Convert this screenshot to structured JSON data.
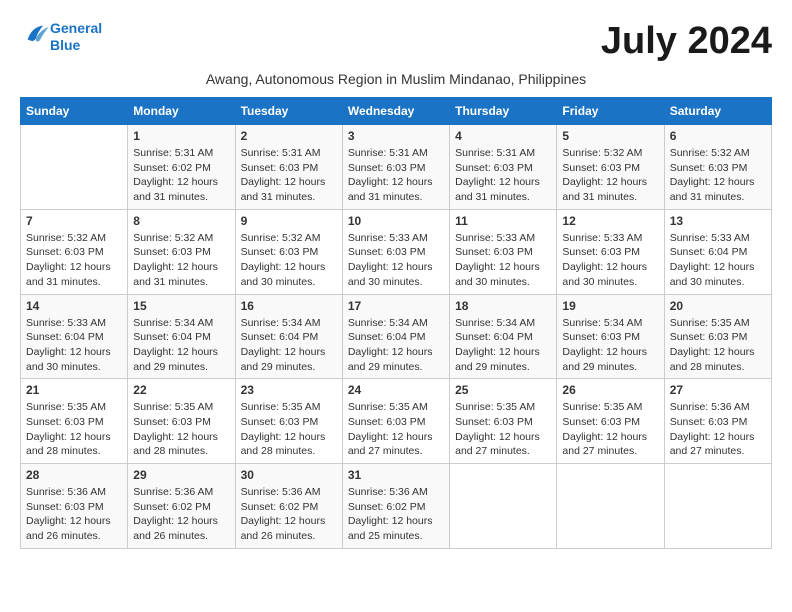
{
  "logo": {
    "line1": "General",
    "line2": "Blue"
  },
  "title": "July 2024",
  "subtitle": "Awang, Autonomous Region in Muslim Mindanao, Philippines",
  "days_header": [
    "Sunday",
    "Monday",
    "Tuesday",
    "Wednesday",
    "Thursday",
    "Friday",
    "Saturday"
  ],
  "weeks": [
    [
      {
        "num": "",
        "info": ""
      },
      {
        "num": "1",
        "info": "Sunrise: 5:31 AM\nSunset: 6:02 PM\nDaylight: 12 hours and 31 minutes."
      },
      {
        "num": "2",
        "info": "Sunrise: 5:31 AM\nSunset: 6:03 PM\nDaylight: 12 hours and 31 minutes."
      },
      {
        "num": "3",
        "info": "Sunrise: 5:31 AM\nSunset: 6:03 PM\nDaylight: 12 hours and 31 minutes."
      },
      {
        "num": "4",
        "info": "Sunrise: 5:31 AM\nSunset: 6:03 PM\nDaylight: 12 hours and 31 minutes."
      },
      {
        "num": "5",
        "info": "Sunrise: 5:32 AM\nSunset: 6:03 PM\nDaylight: 12 hours and 31 minutes."
      },
      {
        "num": "6",
        "info": "Sunrise: 5:32 AM\nSunset: 6:03 PM\nDaylight: 12 hours and 31 minutes."
      }
    ],
    [
      {
        "num": "7",
        "info": "Sunrise: 5:32 AM\nSunset: 6:03 PM\nDaylight: 12 hours and 31 minutes."
      },
      {
        "num": "8",
        "info": "Sunrise: 5:32 AM\nSunset: 6:03 PM\nDaylight: 12 hours and 31 minutes."
      },
      {
        "num": "9",
        "info": "Sunrise: 5:32 AM\nSunset: 6:03 PM\nDaylight: 12 hours and 30 minutes."
      },
      {
        "num": "10",
        "info": "Sunrise: 5:33 AM\nSunset: 6:03 PM\nDaylight: 12 hours and 30 minutes."
      },
      {
        "num": "11",
        "info": "Sunrise: 5:33 AM\nSunset: 6:03 PM\nDaylight: 12 hours and 30 minutes."
      },
      {
        "num": "12",
        "info": "Sunrise: 5:33 AM\nSunset: 6:03 PM\nDaylight: 12 hours and 30 minutes."
      },
      {
        "num": "13",
        "info": "Sunrise: 5:33 AM\nSunset: 6:04 PM\nDaylight: 12 hours and 30 minutes."
      }
    ],
    [
      {
        "num": "14",
        "info": "Sunrise: 5:33 AM\nSunset: 6:04 PM\nDaylight: 12 hours and 30 minutes."
      },
      {
        "num": "15",
        "info": "Sunrise: 5:34 AM\nSunset: 6:04 PM\nDaylight: 12 hours and 29 minutes."
      },
      {
        "num": "16",
        "info": "Sunrise: 5:34 AM\nSunset: 6:04 PM\nDaylight: 12 hours and 29 minutes."
      },
      {
        "num": "17",
        "info": "Sunrise: 5:34 AM\nSunset: 6:04 PM\nDaylight: 12 hours and 29 minutes."
      },
      {
        "num": "18",
        "info": "Sunrise: 5:34 AM\nSunset: 6:04 PM\nDaylight: 12 hours and 29 minutes."
      },
      {
        "num": "19",
        "info": "Sunrise: 5:34 AM\nSunset: 6:03 PM\nDaylight: 12 hours and 29 minutes."
      },
      {
        "num": "20",
        "info": "Sunrise: 5:35 AM\nSunset: 6:03 PM\nDaylight: 12 hours and 28 minutes."
      }
    ],
    [
      {
        "num": "21",
        "info": "Sunrise: 5:35 AM\nSunset: 6:03 PM\nDaylight: 12 hours and 28 minutes."
      },
      {
        "num": "22",
        "info": "Sunrise: 5:35 AM\nSunset: 6:03 PM\nDaylight: 12 hours and 28 minutes."
      },
      {
        "num": "23",
        "info": "Sunrise: 5:35 AM\nSunset: 6:03 PM\nDaylight: 12 hours and 28 minutes."
      },
      {
        "num": "24",
        "info": "Sunrise: 5:35 AM\nSunset: 6:03 PM\nDaylight: 12 hours and 27 minutes."
      },
      {
        "num": "25",
        "info": "Sunrise: 5:35 AM\nSunset: 6:03 PM\nDaylight: 12 hours and 27 minutes."
      },
      {
        "num": "26",
        "info": "Sunrise: 5:35 AM\nSunset: 6:03 PM\nDaylight: 12 hours and 27 minutes."
      },
      {
        "num": "27",
        "info": "Sunrise: 5:36 AM\nSunset: 6:03 PM\nDaylight: 12 hours and 27 minutes."
      }
    ],
    [
      {
        "num": "28",
        "info": "Sunrise: 5:36 AM\nSunset: 6:03 PM\nDaylight: 12 hours and 26 minutes."
      },
      {
        "num": "29",
        "info": "Sunrise: 5:36 AM\nSunset: 6:02 PM\nDaylight: 12 hours and 26 minutes."
      },
      {
        "num": "30",
        "info": "Sunrise: 5:36 AM\nSunset: 6:02 PM\nDaylight: 12 hours and 26 minutes."
      },
      {
        "num": "31",
        "info": "Sunrise: 5:36 AM\nSunset: 6:02 PM\nDaylight: 12 hours and 25 minutes."
      },
      {
        "num": "",
        "info": ""
      },
      {
        "num": "",
        "info": ""
      },
      {
        "num": "",
        "info": ""
      }
    ]
  ]
}
